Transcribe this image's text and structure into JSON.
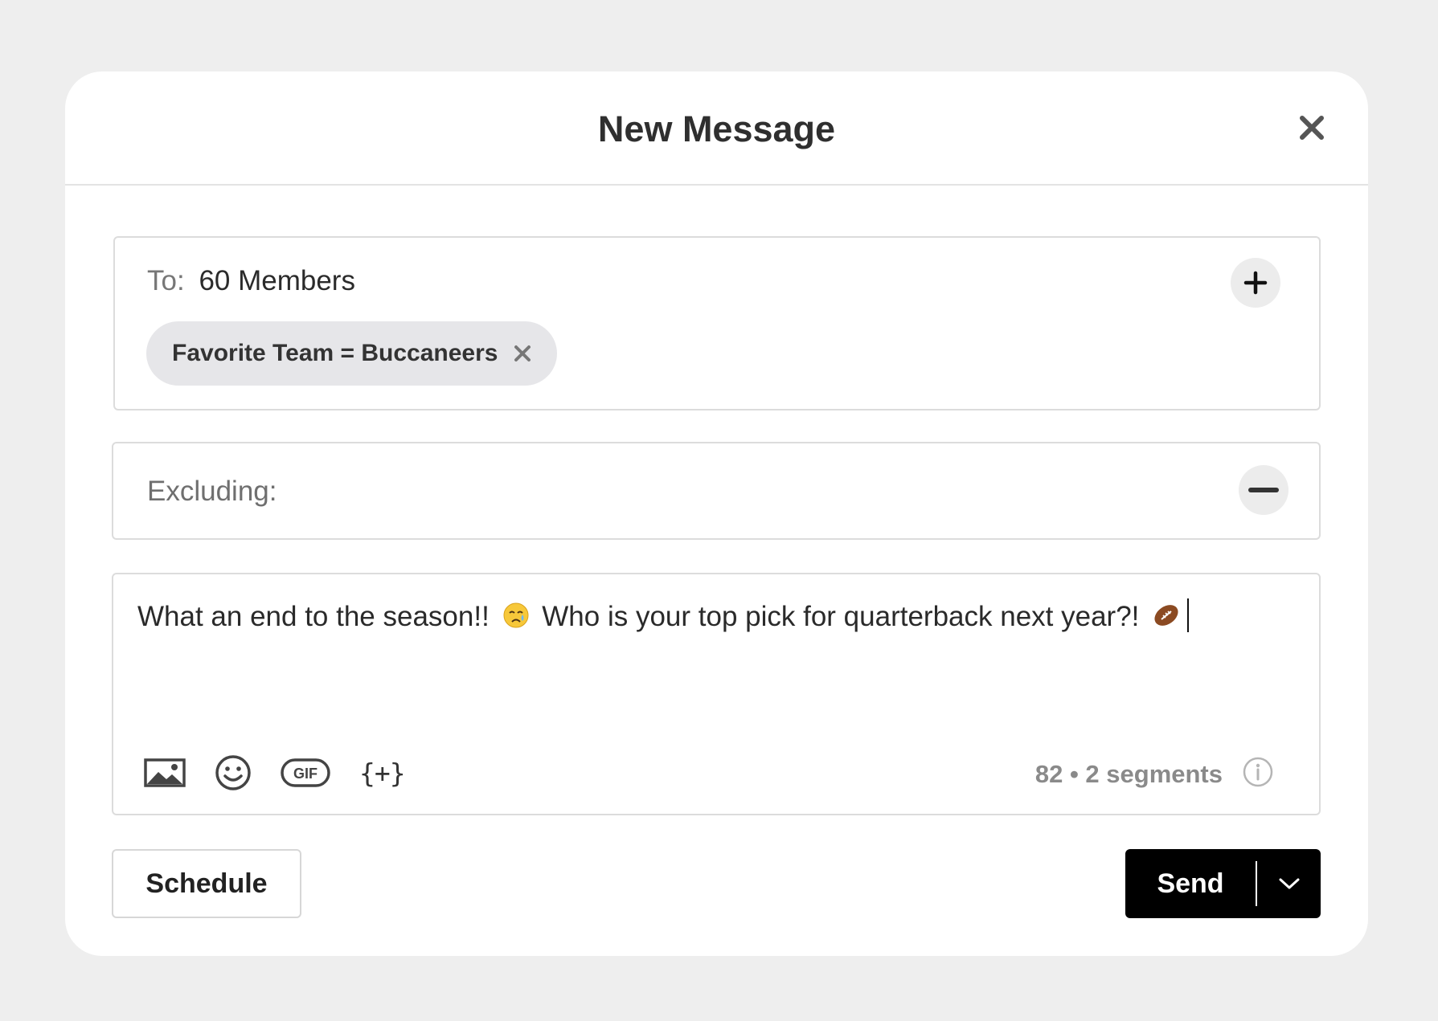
{
  "dialog": {
    "title": "New Message"
  },
  "recipients": {
    "to_label": "To:",
    "to_value": "60 Members",
    "filter_chip": "Favorite Team = Buccaneers"
  },
  "exclusions": {
    "label": "Excluding:"
  },
  "message": {
    "text_part1": "What an end to the season!!",
    "text_part2": "Who is your top pick for quarterback next year?!",
    "emoji_1": "crying-face",
    "emoji_2": "american-football"
  },
  "toolbar": {
    "icons": [
      "image-icon",
      "emoji-icon",
      "gif-icon",
      "variable-icon"
    ],
    "gif_label": "GIF",
    "variable_label": "{+}"
  },
  "counter": {
    "text": "82 • 2 segments"
  },
  "actions": {
    "schedule_label": "Schedule",
    "send_label": "Send"
  },
  "colors": {
    "page_bg": "#eeeeee",
    "send_bg": "#000000",
    "chip_bg": "#e6e6e9"
  }
}
